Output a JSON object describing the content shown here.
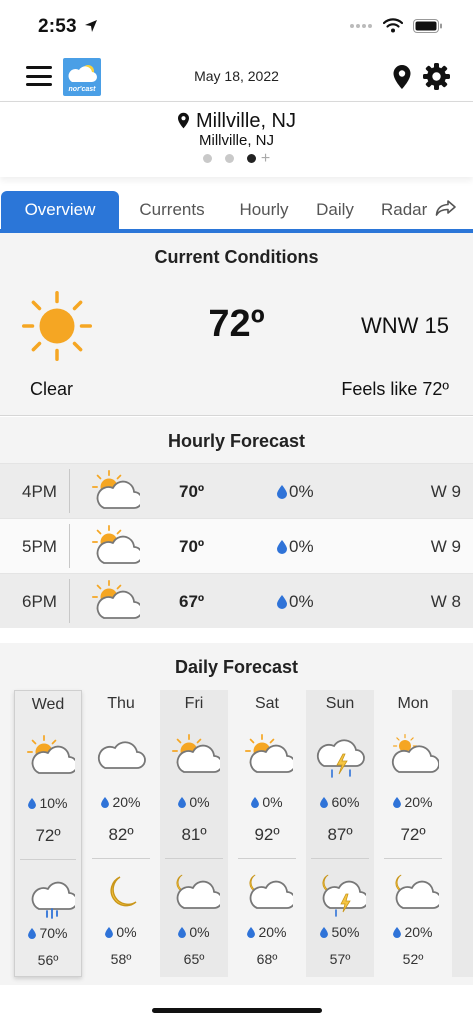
{
  "status_bar": {
    "time": "2:53",
    "icons": [
      "location-arrow-icon",
      "signal-icon",
      "wifi-icon",
      "battery-icon"
    ]
  },
  "header": {
    "date": "May 18, 2022",
    "logo_text": "nor'cast"
  },
  "location": {
    "primary": "Millville, NJ",
    "secondary": "Millville, NJ",
    "pages": 3,
    "active_page": 3
  },
  "tabs": [
    {
      "label": "Overview",
      "active": true
    },
    {
      "label": "Currents"
    },
    {
      "label": "Hourly"
    },
    {
      "label": "Daily"
    },
    {
      "label": "Radar"
    }
  ],
  "current": {
    "title": "Current Conditions",
    "icon": "sun-icon",
    "temp": "72º",
    "wind": "WNW 15",
    "condition": "Clear",
    "feels_like": "Feels like 72º"
  },
  "hourly": {
    "title": "Hourly Forecast",
    "rows": [
      {
        "time": "4PM",
        "icon": "partly-sunny-icon",
        "temp": "70º",
        "precip": "0%",
        "wind": "W 9"
      },
      {
        "time": "5PM",
        "icon": "partly-sunny-icon",
        "temp": "70º",
        "precip": "0%",
        "wind": "W 9"
      },
      {
        "time": "6PM",
        "icon": "partly-sunny-icon",
        "temp": "67º",
        "precip": "0%",
        "wind": "W 8"
      }
    ]
  },
  "daily": {
    "title": "Daily Forecast",
    "days": [
      {
        "name": "Wed",
        "day_icon": "partly-sunny-icon",
        "day_precip": "10%",
        "high": "72º",
        "night_icon": "rain-cloud-icon",
        "night_precip": "70%",
        "low": "56º"
      },
      {
        "name": "Thu",
        "day_icon": "cloud-icon",
        "day_precip": "20%",
        "high": "82º",
        "night_icon": "moon-icon",
        "night_precip": "0%",
        "low": "58º"
      },
      {
        "name": "Fri",
        "day_icon": "partly-sunny-icon",
        "day_precip": "0%",
        "high": "81º",
        "night_icon": "partly-cloudy-night-icon",
        "night_precip": "0%",
        "low": "65º"
      },
      {
        "name": "Sat",
        "day_icon": "partly-sunny-icon",
        "day_precip": "0%",
        "high": "92º",
        "night_icon": "partly-cloudy-night-icon",
        "night_precip": "20%",
        "low": "68º"
      },
      {
        "name": "Sun",
        "day_icon": "thunderstorm-icon",
        "day_precip": "60%",
        "high": "87º",
        "night_icon": "night-thunderstorm-icon",
        "night_precip": "50%",
        "low": "57º"
      },
      {
        "name": "Mon",
        "day_icon": "mostly-cloudy-icon",
        "day_precip": "20%",
        "high": "72º",
        "night_icon": "partly-cloudy-night-icon",
        "night_precip": "20%",
        "low": "52º"
      }
    ]
  },
  "colors": {
    "accent": "#2b76d8",
    "sun": "#f5a623",
    "drop": "#2f73d8"
  }
}
